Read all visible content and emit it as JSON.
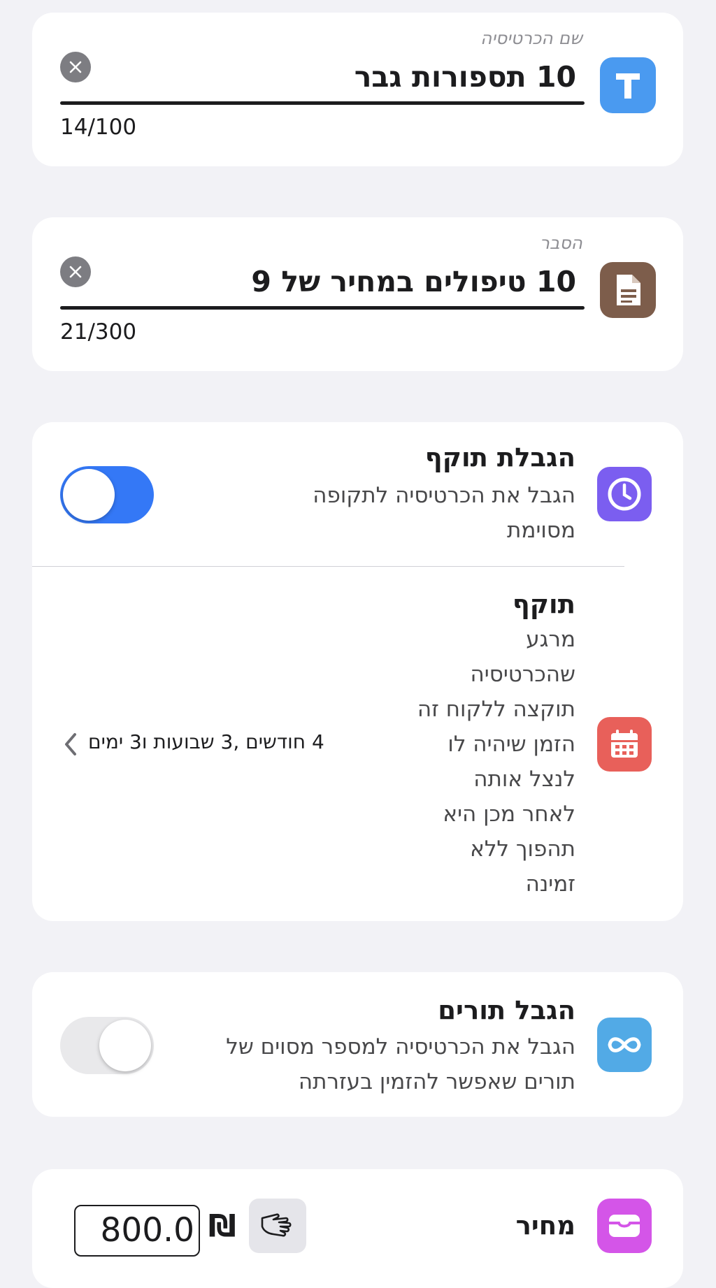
{
  "card_name": {
    "label": "שם הכרטיסיה",
    "value": "10 תספורות גבר",
    "counter": "14/100",
    "icon": "text-t-icon",
    "icon_color": "#4a9af0"
  },
  "description": {
    "label": "הסבר",
    "value": "10 טיפולים במחיר של 9",
    "counter": "21/300",
    "icon": "document-icon",
    "icon_color": "#7d5d4b"
  },
  "validity_limit": {
    "title": "הגבלת תוקף",
    "description": "הגבל את הכרטיסיה לתקופה מסוימת",
    "enabled": true,
    "icon": "clock-icon",
    "icon_color": "#7b5ef0"
  },
  "validity": {
    "title": "תוקף",
    "description": "מרגע\nשהכרטיסיה\nתוקצה ללקוח זה\nהזמן שיהיה לו\nלנצל אותה\nלאחר מכן היא\nתהפוך ללא\nזמינה",
    "value": "4 חודשים ,3 שבועות ו3 ימים",
    "icon": "calendar-icon",
    "icon_color": "#e8605a"
  },
  "appointments_limit": {
    "title": "הגבל תורים",
    "description": "הגבל את הכרטיסיה למספר מסוים של תורים שאפשר להזמין בעזרתה",
    "enabled": false,
    "icon": "infinity-icon",
    "icon_color": "#52aae6"
  },
  "price": {
    "title": "מחיר",
    "currency": "₪",
    "value": "800.0",
    "icon": "wallet-icon",
    "icon_color": "#d455e8"
  },
  "colors": {
    "background": "#f2f2f6",
    "toggle_on": "#3478f6"
  }
}
